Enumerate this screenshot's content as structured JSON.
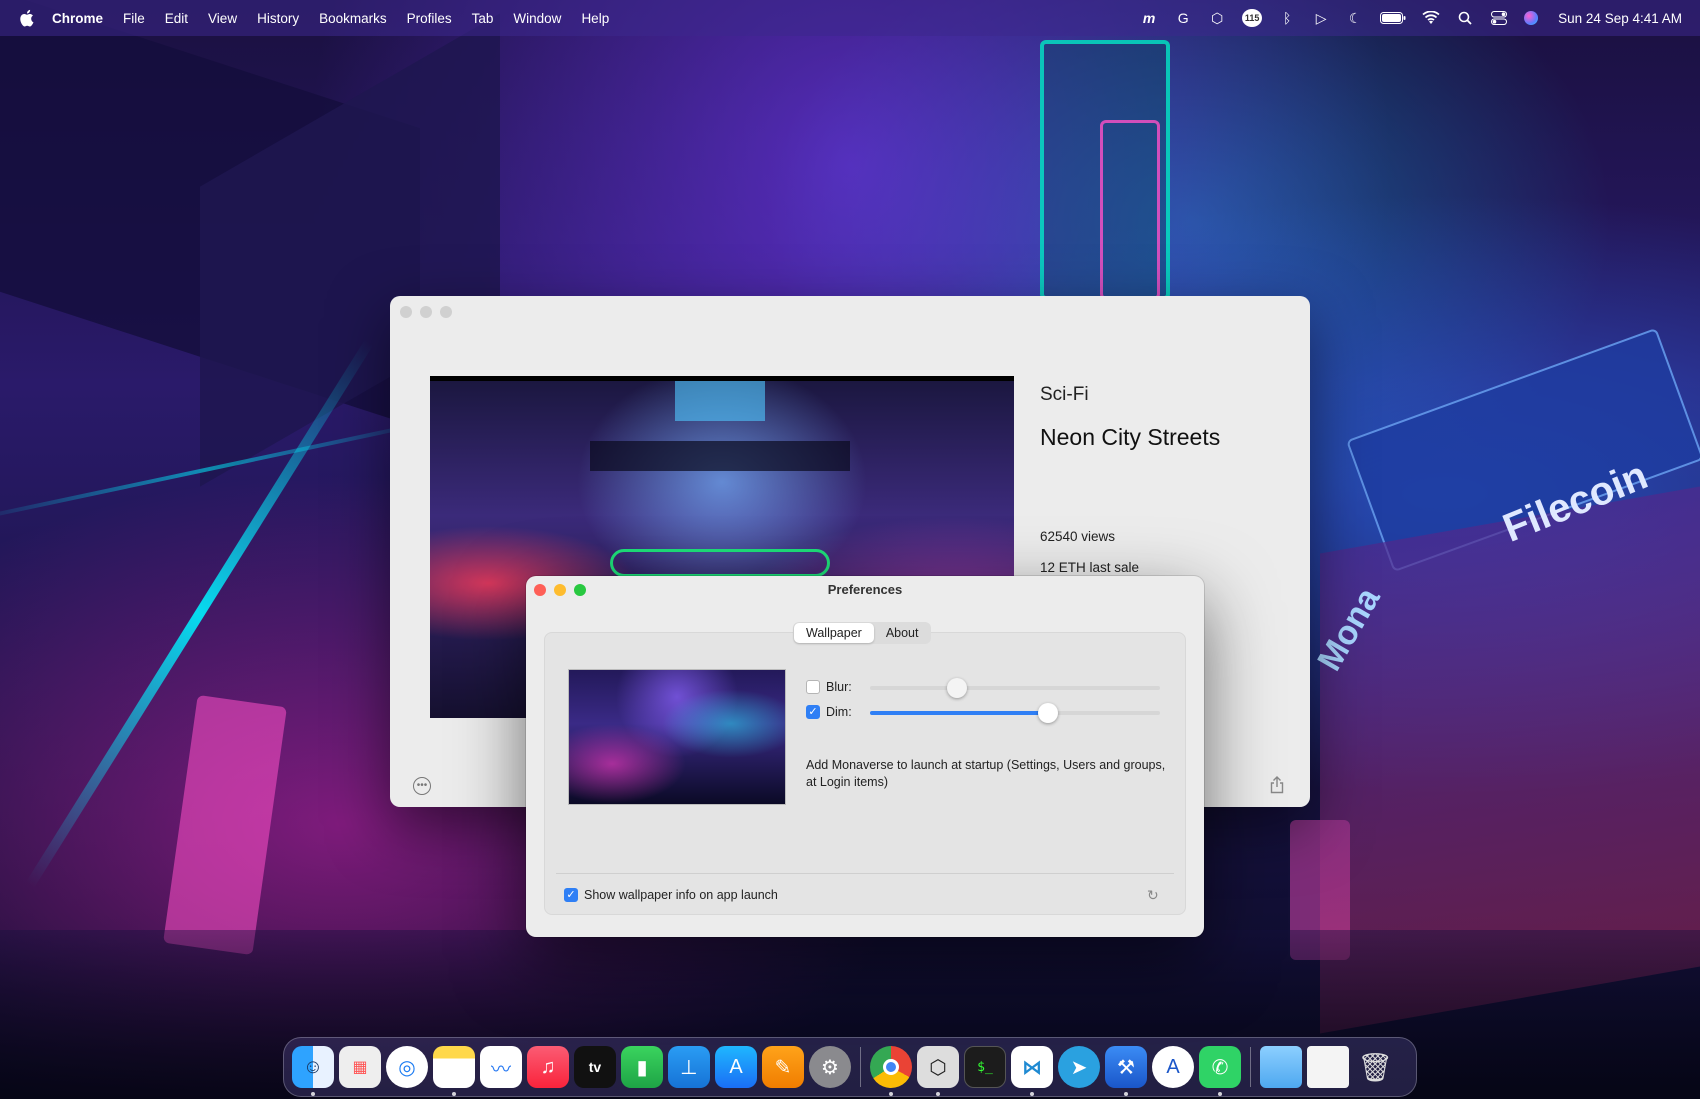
{
  "menubar": {
    "app_name": "Chrome",
    "items": [
      "File",
      "Edit",
      "View",
      "History",
      "Bookmarks",
      "Profiles",
      "Tab",
      "Window",
      "Help"
    ],
    "clock": "Sun 24 Sep  4:41 AM",
    "status_icons": [
      "monaverse-icon",
      "grammarly-icon",
      "unity-icon",
      "badge-115-icon",
      "bluetooth-icon",
      "play-icon",
      "moon-icon",
      "battery-icon",
      "wifi-icon",
      "search-icon",
      "control-center-icon",
      "siri-icon"
    ],
    "badge_count": "115"
  },
  "info_window": {
    "category": "Sci-Fi",
    "title": "Neon City Streets",
    "views": "62540 views",
    "last_sale": "12 ETH last sale"
  },
  "preferences": {
    "title": "Preferences",
    "tabs": [
      "Wallpaper",
      "About"
    ],
    "active_tab": "Wallpaper",
    "blur": {
      "label": "Blur:",
      "checked": false,
      "value": 0.3
    },
    "dim": {
      "label": "Dim:",
      "checked": true,
      "value": 0.61
    },
    "startup_note": "Add Monaverse to launch at startup (Settings, Users and groups, at Login items)",
    "show_info": {
      "label": "Show wallpaper info on app launch",
      "checked": true
    }
  },
  "wallpaper_text": {
    "filecoin": "Filecoin",
    "mona": "Mona"
  },
  "dock": {
    "apps": [
      "Finder",
      "Launchpad",
      "Safari",
      "Notes",
      "Freeform",
      "Music",
      "TV",
      "Numbers",
      "Keynote",
      "App Store",
      "Pages",
      "System Settings",
      "Chrome",
      "Unity",
      "Terminal",
      "VS Code",
      "Telegram",
      "Xcode",
      "Instruments",
      "WhatsApp"
    ],
    "tv_label": "tv",
    "terminal_label": "$_",
    "extras": [
      "Folder",
      "Downloads",
      "Trash"
    ]
  }
}
